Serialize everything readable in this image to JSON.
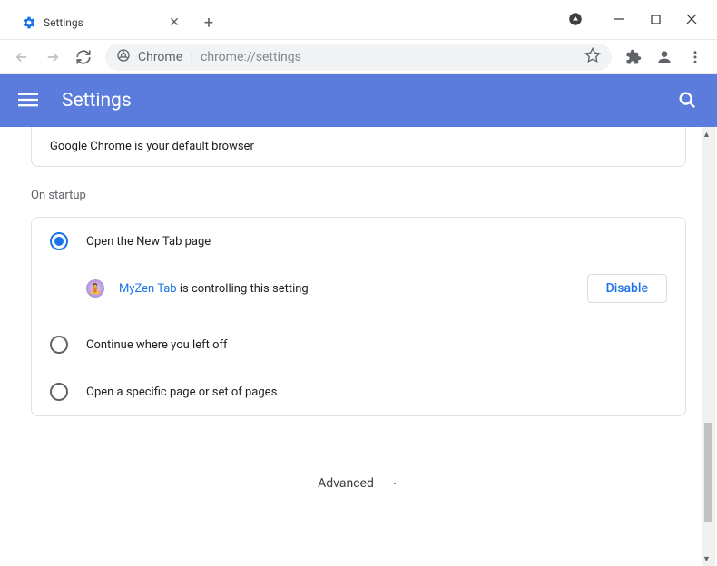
{
  "window": {
    "tab_title": "Settings"
  },
  "addressbar": {
    "prefix": "Chrome",
    "url": "chrome://settings"
  },
  "header": {
    "title": "Settings"
  },
  "default_browser": {
    "text": "Google Chrome is your default browser"
  },
  "startup": {
    "section_label": "On startup",
    "options": [
      {
        "label": "Open the New Tab page",
        "selected": true
      },
      {
        "label": "Continue where you left off",
        "selected": false
      },
      {
        "label": "Open a specific page or set of pages",
        "selected": false
      }
    ],
    "controlling": {
      "ext_name": "MyZen Tab",
      "suffix": " is controlling this setting",
      "disable_label": "Disable"
    }
  },
  "advanced": {
    "label": "Advanced"
  }
}
